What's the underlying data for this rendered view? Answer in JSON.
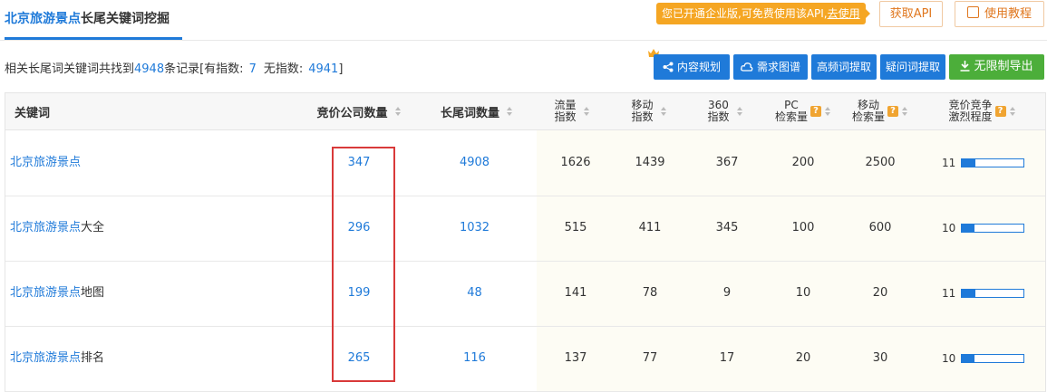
{
  "tab": {
    "highlight": "北京旅游景点",
    "rest": "长尾关键词挖掘"
  },
  "notice": {
    "text": "您已开通企业版,可免费使用该API,",
    "link": "去使用"
  },
  "buttons": {
    "api": "获取API",
    "guide": "使用教程"
  },
  "summary": {
    "prefix": "相关长尾词关键词共找到",
    "total": "4948",
    "mid1": "条记录[有指数:",
    "with_index": "7",
    "mid2": "无指数:",
    "without_index": "4941",
    "suffix": "]"
  },
  "actions": {
    "content_plan": "内容规划",
    "demand_map": "需求图谱",
    "high_freq": "高频词提取",
    "question": "疑问词提取",
    "export": "无限制导出"
  },
  "columns": {
    "keyword": "关键词",
    "companies": "竞价公司数量",
    "longtail": "长尾词数量",
    "traffic": [
      "流量",
      "指数"
    ],
    "mobile": [
      "移动",
      "指数"
    ],
    "i360": [
      "360",
      "指数"
    ],
    "pc": [
      "PC",
      "检索量"
    ],
    "mobile_search": [
      "移动",
      "检索量"
    ],
    "competition": [
      "竞价竞争",
      "激烈程度"
    ]
  },
  "rows": [
    {
      "kw_hl": "北京旅游景点",
      "kw_rest": "",
      "companies": "347",
      "longtail": "4908",
      "traffic": "1626",
      "mobile": "1439",
      "i360": "367",
      "pc": "200",
      "mobile_search": "2500",
      "competition": "11",
      "competition_level": 0.22
    },
    {
      "kw_hl": "北京旅游景点",
      "kw_rest": "大全",
      "companies": "296",
      "longtail": "1032",
      "traffic": "515",
      "mobile": "411",
      "i360": "345",
      "pc": "100",
      "mobile_search": "600",
      "competition": "10",
      "competition_level": 0.2
    },
    {
      "kw_hl": "北京旅游景点",
      "kw_rest": "地图",
      "companies": "199",
      "longtail": "48",
      "traffic": "141",
      "mobile": "78",
      "i360": "9",
      "pc": "10",
      "mobile_search": "20",
      "competition": "11",
      "competition_level": 0.22
    },
    {
      "kw_hl": "北京旅游景点",
      "kw_rest": "排名",
      "companies": "265",
      "longtail": "116",
      "traffic": "137",
      "mobile": "77",
      "i360": "17",
      "pc": "20",
      "mobile_search": "30",
      "competition": "10",
      "competition_level": 0.2
    }
  ],
  "colors": {
    "accent": "#1f7ad9",
    "green": "#4cae3a",
    "orange": "#f5a623",
    "highlight_box": "#d93a3a"
  }
}
